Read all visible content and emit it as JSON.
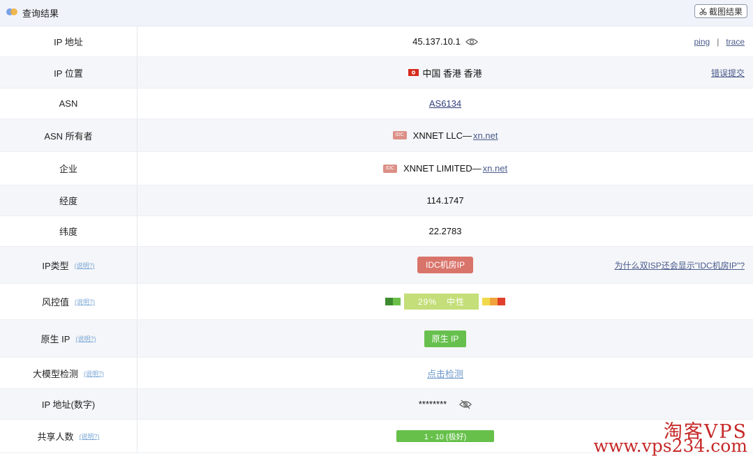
{
  "header": {
    "title": "查询结果",
    "screenshot_label": "截图结果"
  },
  "rows": {
    "ip": {
      "label": "IP 地址",
      "value": "45.137.10.1",
      "ping": "ping",
      "separator": "|",
      "trace": "trace"
    },
    "location": {
      "label": "IP 位置",
      "value": "中国 香港 香港",
      "report": "错误提交"
    },
    "asn": {
      "label": "ASN",
      "value": "AS6134"
    },
    "asn_owner": {
      "label": "ASN 所有者",
      "chip": "IDC",
      "name": "XNNET LLC—",
      "domain": "xn.net"
    },
    "company": {
      "label": "企业",
      "chip": "IDC",
      "name": "XNNET LIMITED—",
      "domain": "xn.net"
    },
    "longitude": {
      "label": "经度",
      "value": "114.1747"
    },
    "latitude": {
      "label": "纬度",
      "value": "22.2783"
    },
    "ip_type": {
      "label": "IP类型",
      "help": "(说明?)",
      "value": "IDC机房IP",
      "why": "为什么双ISP还会显示\"IDC机房IP\"?"
    },
    "risk": {
      "label": "风控值",
      "help": "(说明?)",
      "percent": "29%",
      "level": "中性",
      "score": 29,
      "colors": {
        "low1": "#3d8b2f",
        "low2": "#6cc04a",
        "main": "#c4de79",
        "high1": "#f1d94a",
        "high2": "#f0a33c",
        "high3": "#e0402c"
      }
    },
    "native": {
      "label": "原生 IP",
      "help": "(说明?)",
      "value": "原生 IP"
    },
    "llm": {
      "label": "大模型检测",
      "help": "(说明?)",
      "value": "点击检测"
    },
    "ip_numeric": {
      "label": "IP 地址(数字)",
      "value": "********"
    },
    "share": {
      "label": "共享人数",
      "help": "(说明?)",
      "value": "1 - 10 (极好)"
    }
  },
  "watermark": {
    "line1": "淘客VPS",
    "line2": "www.vps234.com"
  }
}
